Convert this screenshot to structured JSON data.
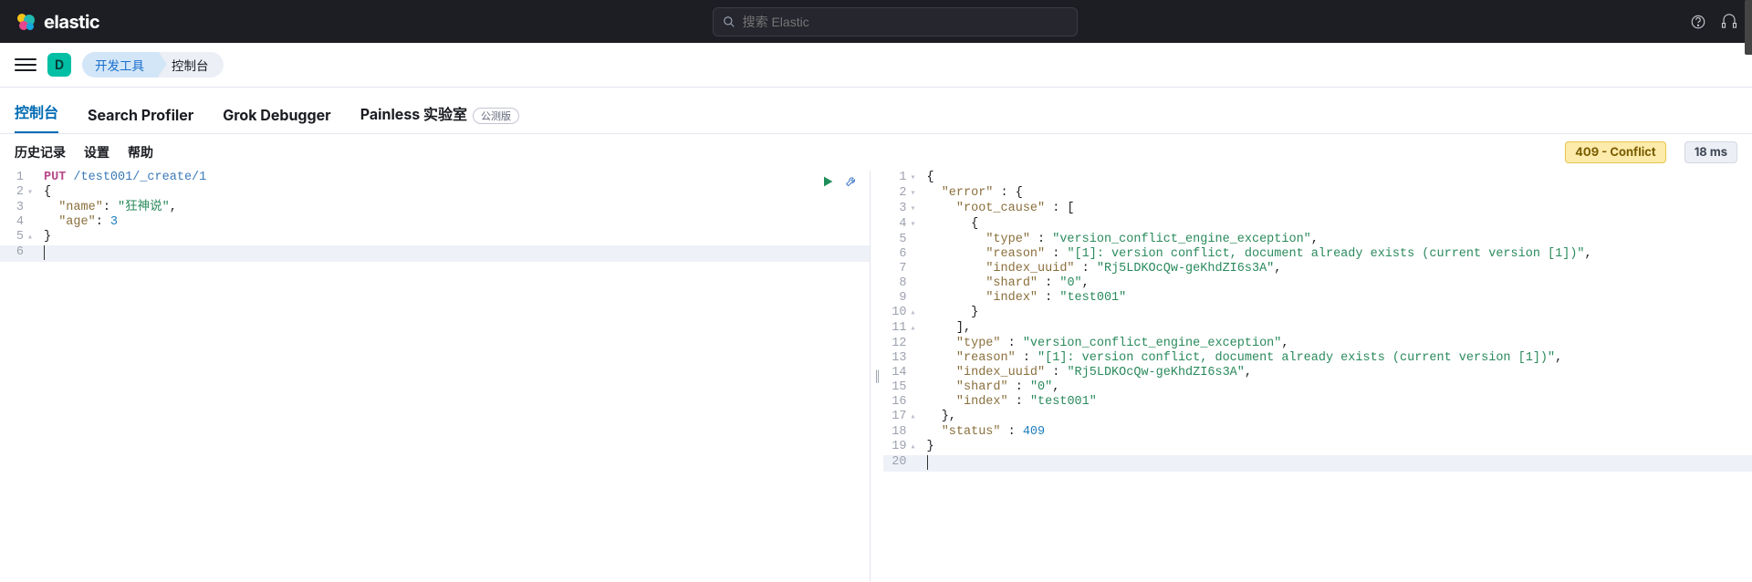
{
  "header": {
    "brand": "elastic",
    "search_placeholder": "搜索 Elastic",
    "space_initial": "D"
  },
  "breadcrumb": {
    "parent": "开发工具",
    "current": "控制台"
  },
  "tabs": [
    {
      "label": "控制台",
      "active": true
    },
    {
      "label": "Search Profiler",
      "active": false
    },
    {
      "label": "Grok Debugger",
      "active": false
    },
    {
      "label": "Painless 实验室",
      "active": false,
      "beta": "公测版"
    }
  ],
  "toolbar_links": {
    "history": "历史记录",
    "settings": "设置",
    "help": "帮助"
  },
  "status_badge": "409 - Conflict",
  "timing_badge": "18 ms",
  "request": {
    "lines": [
      {
        "n": 1,
        "fold": "",
        "tokens": [
          [
            "method",
            "PUT"
          ],
          [
            "plain",
            " "
          ],
          [
            "url",
            "/test001/_create/1"
          ]
        ]
      },
      {
        "n": 2,
        "fold": "▾",
        "tokens": [
          [
            "plain",
            "{"
          ]
        ]
      },
      {
        "n": 3,
        "fold": "",
        "tokens": [
          [
            "plain",
            "  "
          ],
          [
            "key",
            "\"name\""
          ],
          [
            "plain",
            ": "
          ],
          [
            "str",
            "\"狂神说\""
          ],
          [
            "plain",
            ","
          ]
        ]
      },
      {
        "n": 4,
        "fold": "",
        "tokens": [
          [
            "plain",
            "  "
          ],
          [
            "key",
            "\"age\""
          ],
          [
            "plain",
            ": "
          ],
          [
            "num",
            "3"
          ]
        ]
      },
      {
        "n": 5,
        "fold": "▴",
        "tokens": [
          [
            "plain",
            "}"
          ]
        ]
      },
      {
        "n": 6,
        "fold": "",
        "tokens": [],
        "cursor": true
      }
    ]
  },
  "response": {
    "lines": [
      {
        "n": 1,
        "fold": "▾",
        "tokens": [
          [
            "plain",
            "{"
          ]
        ]
      },
      {
        "n": 2,
        "fold": "▾",
        "tokens": [
          [
            "plain",
            "  "
          ],
          [
            "key",
            "\"error\""
          ],
          [
            "plain",
            " : {"
          ]
        ]
      },
      {
        "n": 3,
        "fold": "▾",
        "tokens": [
          [
            "plain",
            "    "
          ],
          [
            "key",
            "\"root_cause\""
          ],
          [
            "plain",
            " : ["
          ]
        ]
      },
      {
        "n": 4,
        "fold": "▾",
        "tokens": [
          [
            "plain",
            "      {"
          ]
        ]
      },
      {
        "n": 5,
        "fold": "",
        "tokens": [
          [
            "plain",
            "        "
          ],
          [
            "key",
            "\"type\""
          ],
          [
            "plain",
            " : "
          ],
          [
            "str",
            "\"version_conflict_engine_exception\""
          ],
          [
            "plain",
            ","
          ]
        ]
      },
      {
        "n": 6,
        "fold": "",
        "tokens": [
          [
            "plain",
            "        "
          ],
          [
            "key",
            "\"reason\""
          ],
          [
            "plain",
            " : "
          ],
          [
            "str",
            "\"[1]: version conflict, document already exists (current version [1])\""
          ],
          [
            "plain",
            ","
          ]
        ]
      },
      {
        "n": 7,
        "fold": "",
        "tokens": [
          [
            "plain",
            "        "
          ],
          [
            "key",
            "\"index_uuid\""
          ],
          [
            "plain",
            " : "
          ],
          [
            "str",
            "\"Rj5LDKOcQw-geKhdZI6s3A\""
          ],
          [
            "plain",
            ","
          ]
        ]
      },
      {
        "n": 8,
        "fold": "",
        "tokens": [
          [
            "plain",
            "        "
          ],
          [
            "key",
            "\"shard\""
          ],
          [
            "plain",
            " : "
          ],
          [
            "str",
            "\"0\""
          ],
          [
            "plain",
            ","
          ]
        ]
      },
      {
        "n": 9,
        "fold": "",
        "tokens": [
          [
            "plain",
            "        "
          ],
          [
            "key",
            "\"index\""
          ],
          [
            "plain",
            " : "
          ],
          [
            "str",
            "\"test001\""
          ]
        ]
      },
      {
        "n": 10,
        "fold": "▴",
        "tokens": [
          [
            "plain",
            "      }"
          ]
        ]
      },
      {
        "n": 11,
        "fold": "▴",
        "tokens": [
          [
            "plain",
            "    ],"
          ]
        ]
      },
      {
        "n": 12,
        "fold": "",
        "tokens": [
          [
            "plain",
            "    "
          ],
          [
            "key",
            "\"type\""
          ],
          [
            "plain",
            " : "
          ],
          [
            "str",
            "\"version_conflict_engine_exception\""
          ],
          [
            "plain",
            ","
          ]
        ]
      },
      {
        "n": 13,
        "fold": "",
        "tokens": [
          [
            "plain",
            "    "
          ],
          [
            "key",
            "\"reason\""
          ],
          [
            "plain",
            " : "
          ],
          [
            "str",
            "\"[1]: version conflict, document already exists (current version [1])\""
          ],
          [
            "plain",
            ","
          ]
        ]
      },
      {
        "n": 14,
        "fold": "",
        "tokens": [
          [
            "plain",
            "    "
          ],
          [
            "key",
            "\"index_uuid\""
          ],
          [
            "plain",
            " : "
          ],
          [
            "str",
            "\"Rj5LDKOcQw-geKhdZI6s3A\""
          ],
          [
            "plain",
            ","
          ]
        ]
      },
      {
        "n": 15,
        "fold": "",
        "tokens": [
          [
            "plain",
            "    "
          ],
          [
            "key",
            "\"shard\""
          ],
          [
            "plain",
            " : "
          ],
          [
            "str",
            "\"0\""
          ],
          [
            "plain",
            ","
          ]
        ]
      },
      {
        "n": 16,
        "fold": "",
        "tokens": [
          [
            "plain",
            "    "
          ],
          [
            "key",
            "\"index\""
          ],
          [
            "plain",
            " : "
          ],
          [
            "str",
            "\"test001\""
          ]
        ]
      },
      {
        "n": 17,
        "fold": "▴",
        "tokens": [
          [
            "plain",
            "  },"
          ]
        ]
      },
      {
        "n": 18,
        "fold": "",
        "tokens": [
          [
            "plain",
            "  "
          ],
          [
            "key",
            "\"status\""
          ],
          [
            "plain",
            " : "
          ],
          [
            "num",
            "409"
          ]
        ]
      },
      {
        "n": 19,
        "fold": "▴",
        "tokens": [
          [
            "plain",
            "}"
          ]
        ]
      },
      {
        "n": 20,
        "fold": "",
        "tokens": [],
        "cursor": true
      }
    ]
  }
}
